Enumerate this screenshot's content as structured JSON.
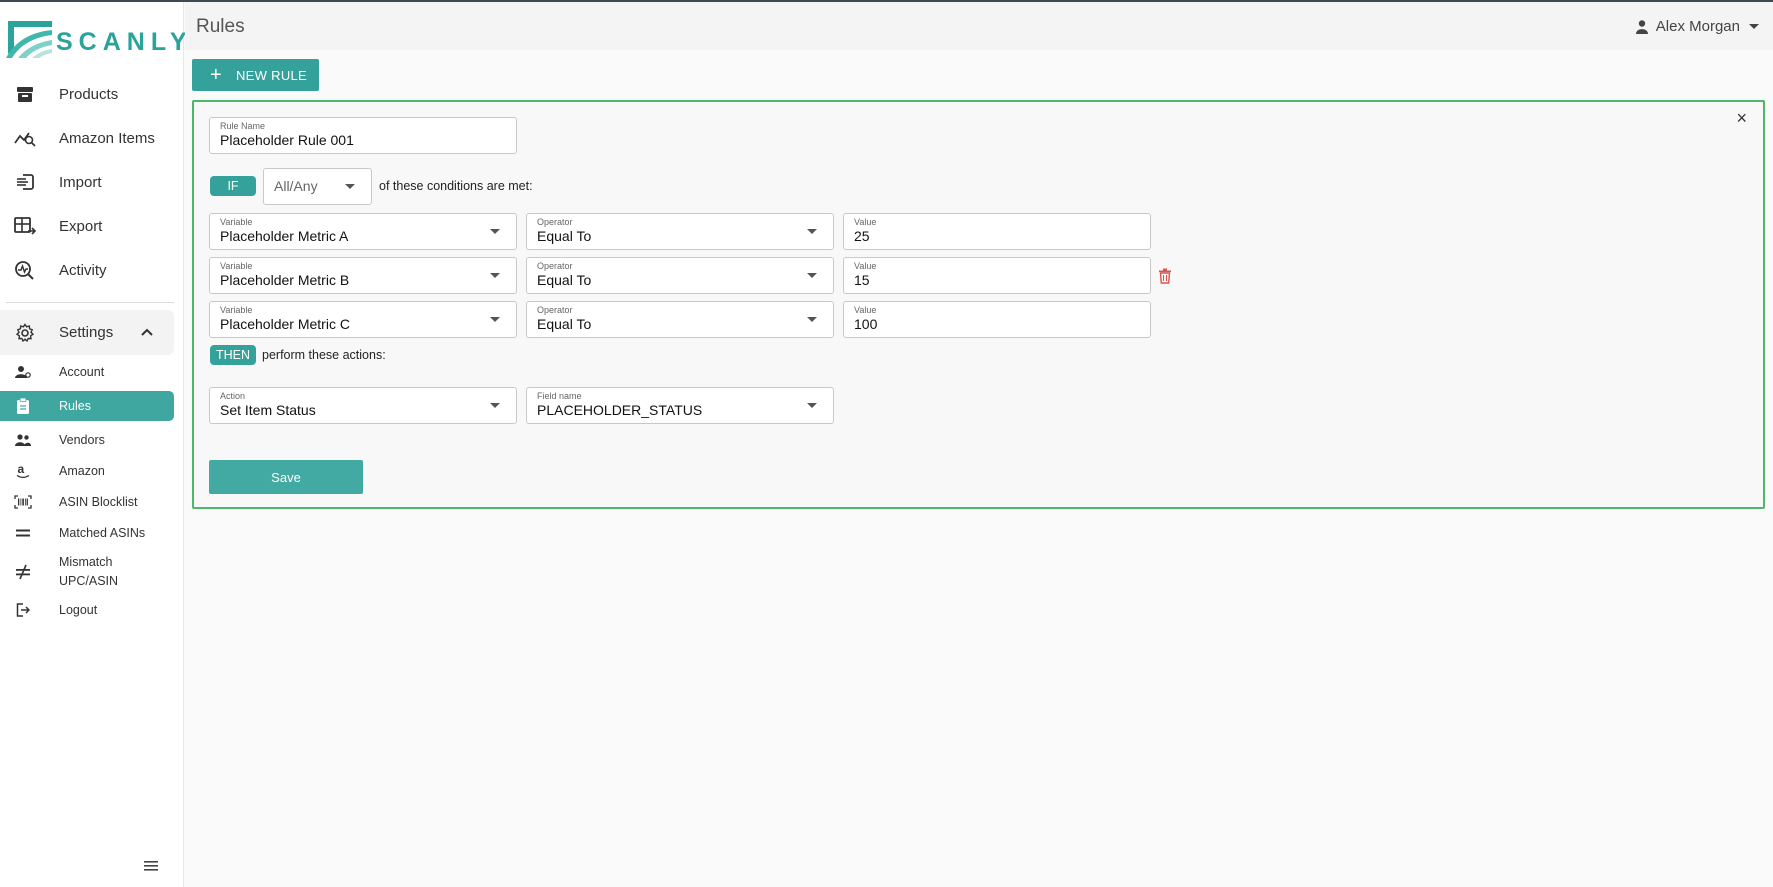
{
  "app": {
    "brand": "SCANLY",
    "brand_color": "#2aa39b",
    "accent_color": "#35a19b"
  },
  "header": {
    "page_title": "Rules",
    "user_name": "Alex Morgan"
  },
  "sidebar": {
    "main_items": [
      {
        "label": "Products",
        "icon": "archive-box-icon"
      },
      {
        "label": "Amazon Items",
        "icon": "chart-search-icon"
      },
      {
        "label": "Import",
        "icon": "import-icon"
      },
      {
        "label": "Export",
        "icon": "table-export-icon"
      },
      {
        "label": "Activity",
        "icon": "activity-search-icon"
      }
    ],
    "settings_label": "Settings",
    "sub_items": [
      {
        "label": "Account",
        "icon": "user-settings-icon"
      },
      {
        "label": "Rules",
        "icon": "clipboard-icon",
        "active": true
      },
      {
        "label": "Vendors",
        "icon": "people-icon"
      },
      {
        "label": "Amazon",
        "icon": "amazon-icon"
      },
      {
        "label": "ASIN Blocklist",
        "icon": "barcode-icon"
      },
      {
        "label": "Matched ASINs",
        "icon": "equals-icon"
      },
      {
        "label_line1": "Mismatch",
        "label_line2": "UPC/ASIN",
        "icon": "not-equal-icon"
      },
      {
        "label": "Logout",
        "icon": "logout-icon"
      }
    ]
  },
  "toolbar": {
    "new_rule_label": "NEW RULE"
  },
  "rule": {
    "name_label": "Rule Name",
    "name_value": "Placeholder Rule 001",
    "if_label": "IF",
    "match_mode": "All/Any",
    "conditions_text": "of these conditions are met:",
    "conditions": [
      {
        "variable_label": "Variable",
        "variable": "Placeholder Metric A",
        "operator_label": "Operator",
        "operator": "Equal To",
        "value_label": "Value",
        "value": "25"
      },
      {
        "variable_label": "Variable",
        "variable": "Placeholder Metric B",
        "operator_label": "Operator",
        "operator": "Equal To",
        "value_label": "Value",
        "value": "15"
      },
      {
        "variable_label": "Variable",
        "variable": "Placeholder Metric C",
        "operator_label": "Operator",
        "operator": "Equal To",
        "value_label": "Value",
        "value": "100"
      }
    ],
    "then_label": "THEN",
    "actions_text": "perform these actions:",
    "action": {
      "action_label": "Action",
      "action_value": "Set Item Status",
      "field_label": "Field name",
      "field_value": "PLACEHOLDER_STATUS"
    },
    "save_label": "Save",
    "close_symbol": "×"
  }
}
